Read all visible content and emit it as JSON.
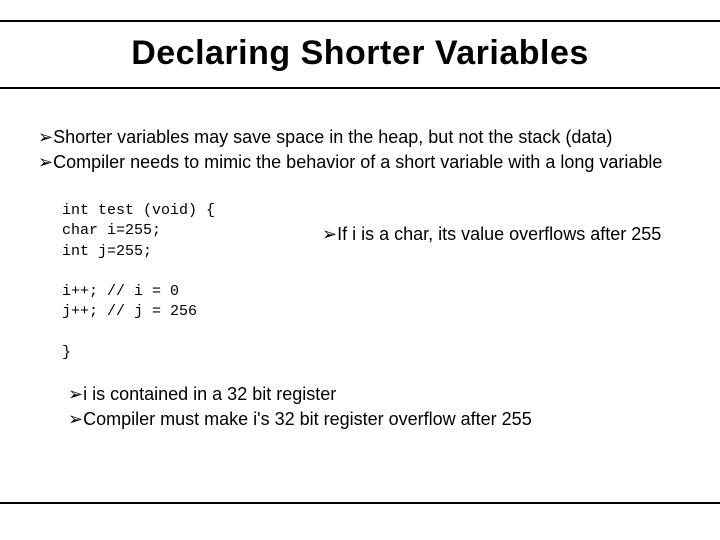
{
  "title": "Declaring Shorter Variables",
  "bullets_top": [
    "Shorter variables may save space in the heap, but not the stack (data)",
    "Compiler needs to mimic the behavior of a short variable with a long variable"
  ],
  "code": "int test (void) {\nchar i=255;\nint j=255;\n\ni++; // i = 0\nj++; // j = 256\n\n}",
  "side_bullets": [
    "If i is a char, its value overflows after 255"
  ],
  "bottom_bullets": [
    "i is contained in a 32 bit register",
    "Compiler must make i's 32 bit register overflow after 255"
  ],
  "arrow_glyph": "➢"
}
